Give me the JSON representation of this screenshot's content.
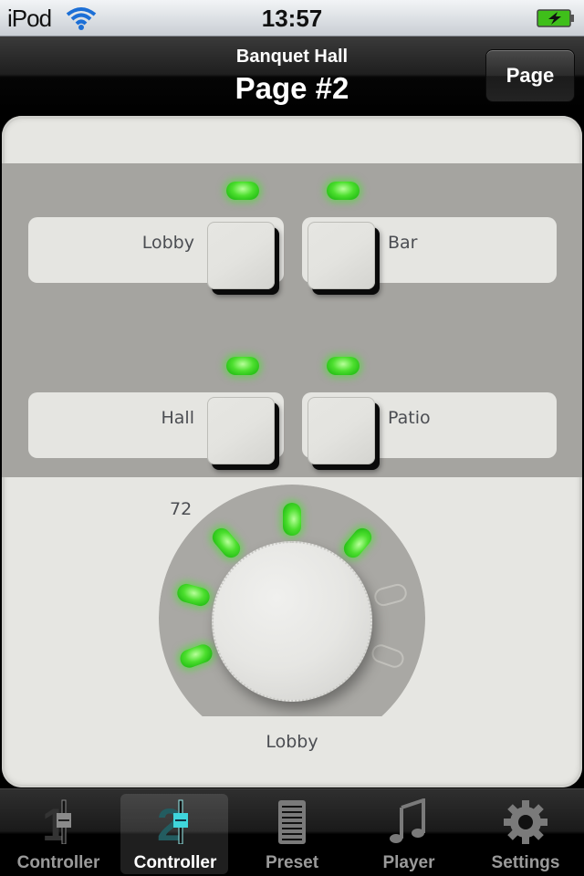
{
  "status_bar": {
    "carrier": "iPod",
    "time": "13:57",
    "wifi_icon": "wifi-icon",
    "battery_icon": "battery-charging-icon"
  },
  "nav_bar": {
    "subtitle": "Banquet Hall",
    "title": "Page #2",
    "page_button_label": "Page"
  },
  "zones": [
    {
      "label": "Lobby",
      "led_on": true
    },
    {
      "label": "Bar",
      "led_on": true
    },
    {
      "label": "Hall",
      "led_on": true
    },
    {
      "label": "Patio",
      "led_on": true
    }
  ],
  "volume_knob": {
    "value": "72",
    "label": "Lobby",
    "leds_total": 7,
    "leds_lit": 5
  },
  "tab_bar": {
    "active_index": 1,
    "tabs": [
      {
        "label": "Controller",
        "icon": "controller-1-icon"
      },
      {
        "label": "Controller",
        "icon": "controller-2-icon"
      },
      {
        "label": "Preset",
        "icon": "preset-list-icon"
      },
      {
        "label": "Player",
        "icon": "music-note-icon"
      },
      {
        "label": "Settings",
        "icon": "gear-icon"
      }
    ]
  },
  "colors": {
    "led_green": "#4cdf2e",
    "panel": "#e6e6e2",
    "band": "#a5a4a0",
    "active_slider_accent": "#3fd6dc"
  }
}
